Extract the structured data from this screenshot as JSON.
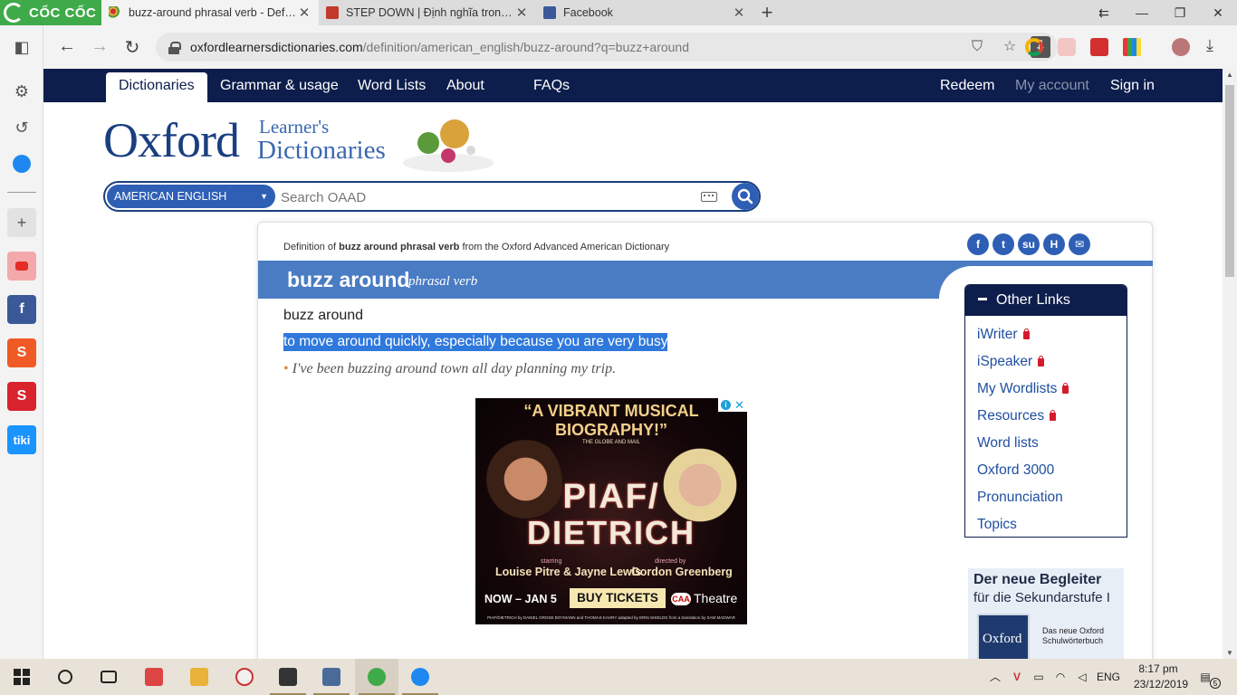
{
  "browser": {
    "brand": "CỐC CỐC",
    "tabs": [
      {
        "title": "buzz-around phrasal verb - Definiti",
        "active": true
      },
      {
        "title": "STEP DOWN | Định nghĩa trong Từ",
        "active": false
      },
      {
        "title": "Facebook",
        "active": false
      }
    ],
    "url_host": "oxfordlearnersdictionaries.com",
    "url_path": "/definition/american_english/buzz-around?q=buzz+around"
  },
  "oxford_nav": {
    "items": [
      "Dictionaries",
      "Grammar & usage",
      "Word Lists",
      "About",
      "FAQs"
    ],
    "right": [
      "Redeem",
      "My account",
      "Sign in"
    ]
  },
  "logo": {
    "main": "Oxford",
    "line1": "Learner's",
    "line2": "Dictionaries"
  },
  "search": {
    "dictionary": "AMERICAN ENGLISH",
    "placeholder": "Search OAAD"
  },
  "entry": {
    "breadcrumb_prefix": "Definition of ",
    "breadcrumb_term": "buzz around phrasal verb",
    "breadcrumb_suffix": " from the Oxford Advanced American Dictionary",
    "headword": "buzz around",
    "pos": "phrasal verb",
    "sense_title": "buzz around",
    "definition": "to move around quickly, especially because you are very busy",
    "example_bullet": "•",
    "example": "I've been buzzing around town all day planning my trip."
  },
  "ad": {
    "quote_line1": "“A VIBRANT MUSICAL",
    "quote_line2": "BIOGRAPHY!”",
    "quote_source": "THE GLOBE AND MAIL",
    "title_line1": "PIAF/",
    "title_line2": "DIETRICH",
    "starring_label": "starring",
    "starring": "Louise Pitre & Jayne Lewis",
    "directed_label": "directed by",
    "director": "Gordon Greenberg",
    "dates": "NOW – JAN 5",
    "cta": "BUY TICKETS",
    "venue": "Theatre",
    "venue_logo": "CAA",
    "credits": "PIAF/DIETRICH by DANIEL GROSE BOYMANN and THOMAS KAHRY adapted by ERIN SHIELDS from a translation by SAM MADWAR"
  },
  "other_links": {
    "title": "Other Links",
    "items": [
      {
        "label": "iWriter",
        "locked": true
      },
      {
        "label": "iSpeaker",
        "locked": true
      },
      {
        "label": "My Wordlists",
        "locked": true
      },
      {
        "label": "Resources",
        "locked": true
      },
      {
        "label": "Word lists",
        "locked": false
      },
      {
        "label": "Oxford 3000",
        "locked": false
      },
      {
        "label": "Pronunciation",
        "locked": false
      },
      {
        "label": "Topics",
        "locked": false
      }
    ]
  },
  "promo": {
    "line1": "Der neue Begleiter",
    "line2": "für die Sekundarstufe I",
    "book_title": "Oxford",
    "text_line1": "Das neue Oxford",
    "text_line2": "Schulwörterbuch"
  },
  "taskbar": {
    "lang": "ENG",
    "time": "8:17 pm",
    "date": "23/12/2019",
    "notifications": "5"
  },
  "colors": {
    "oxford_navy": "#0d1e4c",
    "oxford_blue": "#4a7cc4",
    "selection": "#2f78dc",
    "coccoc_green": "#3faa49"
  }
}
